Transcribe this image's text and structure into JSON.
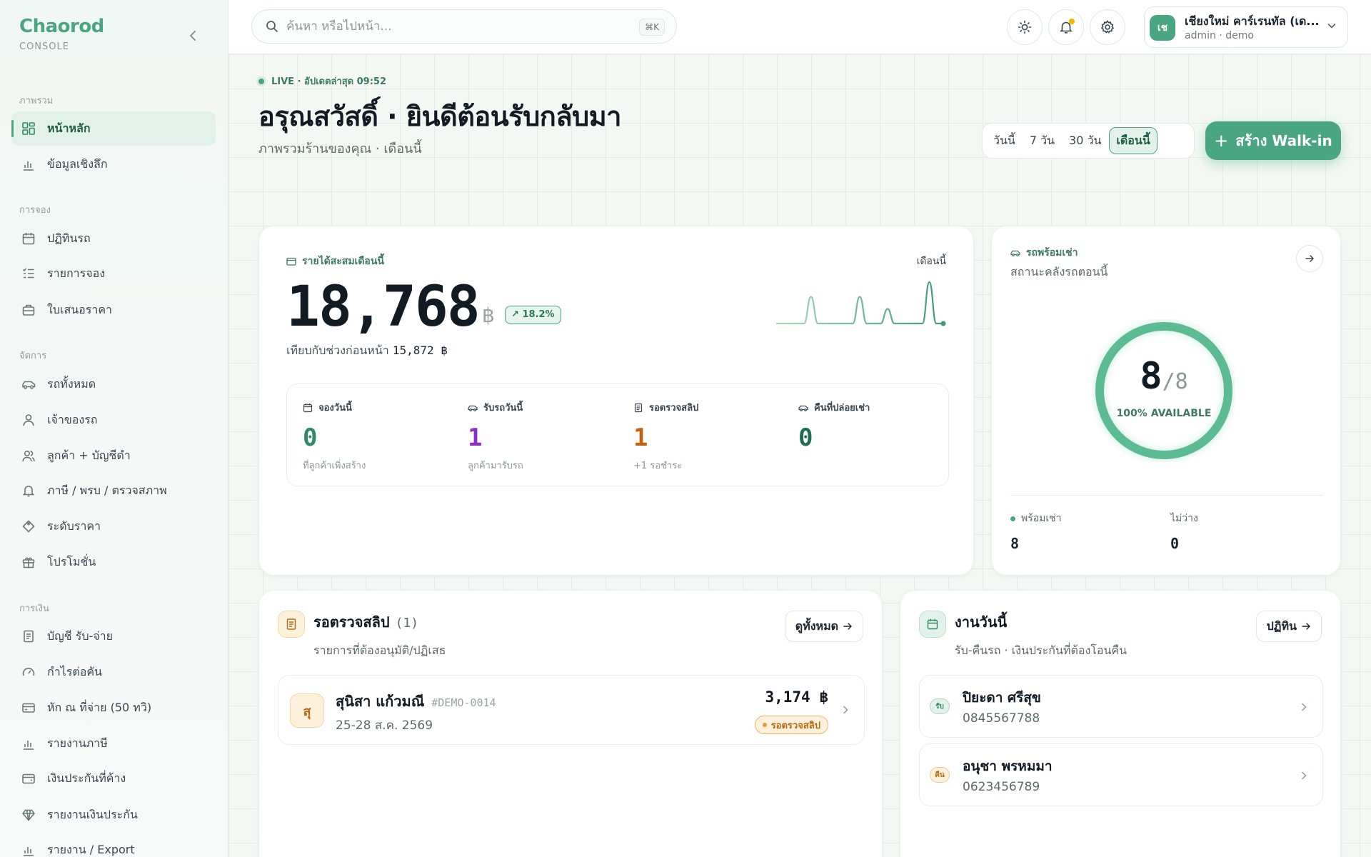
{
  "brand": {
    "name": "Chaorod",
    "sub": "CONSOLE"
  },
  "nav": {
    "sections": [
      {
        "title": "ภาพรวม",
        "items": [
          {
            "label": "หน้าหลัก",
            "icon": "dashboard-icon",
            "active": true
          },
          {
            "label": "ข้อมูลเชิงลึก",
            "icon": "bar-chart-icon"
          }
        ]
      },
      {
        "title": "การจอง",
        "items": [
          {
            "label": "ปฏิทินรถ",
            "icon": "calendar-icon"
          },
          {
            "label": "รายการจอง",
            "icon": "checklist-icon"
          },
          {
            "label": "ใบเสนอราคา",
            "icon": "briefcase-icon"
          }
        ]
      },
      {
        "title": "จัดการ",
        "items": [
          {
            "label": "รถทั้งหมด",
            "icon": "car-icon"
          },
          {
            "label": "เจ้าของรถ",
            "icon": "user-icon"
          },
          {
            "label": "ลูกค้า + บัญชีดำ",
            "icon": "users-icon"
          },
          {
            "label": "ภาษี / พรบ / ตรวจสภาพ",
            "icon": "bell-icon"
          },
          {
            "label": "ระดับราคา",
            "icon": "tag-icon"
          },
          {
            "label": "โปรโมชั่น",
            "icon": "gift-icon"
          }
        ]
      },
      {
        "title": "การเงิน",
        "items": [
          {
            "label": "บัญชี รับ-จ่าย",
            "icon": "receipt-icon"
          },
          {
            "label": "กำไรต่อคัน",
            "icon": "gauge-icon"
          },
          {
            "label": "หัก ณ ที่จ่าย (50 ทวิ)",
            "icon": "credit-card-icon"
          },
          {
            "label": "รายงานภาษี",
            "icon": "bar-chart-icon"
          },
          {
            "label": "เงินประกันที่ค้าง",
            "icon": "wallet-icon"
          },
          {
            "label": "รายงานเงินประกัน",
            "icon": "diamond-icon"
          },
          {
            "label": "รายงาน / Export",
            "icon": "bar-chart-icon"
          }
        ]
      }
    ]
  },
  "topbar": {
    "search_placeholder": "ค้นหา หรือไปหน้า...",
    "search_shortcut": "⌘K",
    "user": {
      "initials": "เช",
      "name": "เชียงใหม่ คาร์เรนทัล (เด...",
      "role": "admin · demo"
    }
  },
  "header": {
    "live": "LIVE · อัปเดตล่าสุด 09:52",
    "title": "อรุณสวัสดิ์ · ยินดีต้อนรับกลับมา",
    "subtitle": "ภาพรวมร้านของคุณ · เดือนนี้",
    "ranges": [
      "วันนี้",
      "7 วัน",
      "30 วัน",
      "เดือนนี้"
    ],
    "active_range": "เดือนนี้",
    "walkin_label": "สร้าง Walk-in"
  },
  "revenue": {
    "label": "รายได้สะสมเดือนนี้",
    "period": "เดือนนี้",
    "value": "18,768",
    "currency": "฿",
    "change": "18.2%",
    "compare_label": "เทียบกับช่วงก่อนหน้า",
    "compare_value": "15,872 ฿",
    "sparkline": [
      0,
      0,
      0,
      0,
      0,
      1.1,
      0,
      0,
      0,
      0,
      0,
      0,
      1.1,
      0,
      0,
      0,
      0.6,
      0,
      0,
      0,
      0,
      0,
      1.7,
      0,
      0
    ],
    "stats": [
      {
        "label": "จองวันนี้",
        "icon": "calendar-icon",
        "value": "0",
        "note": "ที่ลูกค้าเพิ่งสร้าง",
        "color": "#2f8a66"
      },
      {
        "label": "รับรถวันนี้",
        "icon": "car-icon",
        "value": "1",
        "note": "ลูกค้ามารับรถ",
        "color": "#8a2fc4"
      },
      {
        "label": "รอตรวจสลิป",
        "icon": "receipt-icon",
        "value": "1",
        "note": "+1 รอชำระ",
        "color": "#c0620e"
      },
      {
        "label": "คืนที่ปล่อยเช่า",
        "icon": "car-icon",
        "value": "0",
        "note": "",
        "color": "#1f6e50"
      }
    ]
  },
  "fleet": {
    "label": "รถพร้อมเช่า",
    "subtitle": "สถานะคลังรถตอนนี้",
    "available": "8",
    "total": "/8",
    "available_fraction": 1.0,
    "caption": "100% AVAILABLE",
    "ready_label": "พร้อมเช่า",
    "ready_value": "8",
    "busy_label": "ไม่ว่าง",
    "busy_value": "0"
  },
  "slips": {
    "title": "รอตรวจสลิป",
    "count": "(1)",
    "subtitle": "รายการที่ต้องอนุมัติ/ปฏิเสธ",
    "view_all": "ดูทั้งหมด",
    "items": [
      {
        "initial": "สุ",
        "name": "สุนิสา แก้วมณี",
        "code": "#DEMO-0014",
        "dates": "25-28 ส.ค. 2569",
        "amount": "3,174 ฿",
        "status": "รอตรวจสลิป"
      }
    ]
  },
  "today": {
    "title": "งานวันนี้",
    "subtitle": "รับ-คืนรถ · เงินประกันที่ต้องโอนคืน",
    "calendar_btn": "ปฏิทิน",
    "items": [
      {
        "tag": "รับ",
        "name": "ปิยะดา ศรีสุข",
        "phone": "0845567788"
      },
      {
        "tag": "คืน",
        "name": "อนุชา พรหมมา",
        "phone": "0623456789"
      }
    ]
  },
  "colors": {
    "accent": "#4aa682",
    "pending": "#e79a3a"
  }
}
